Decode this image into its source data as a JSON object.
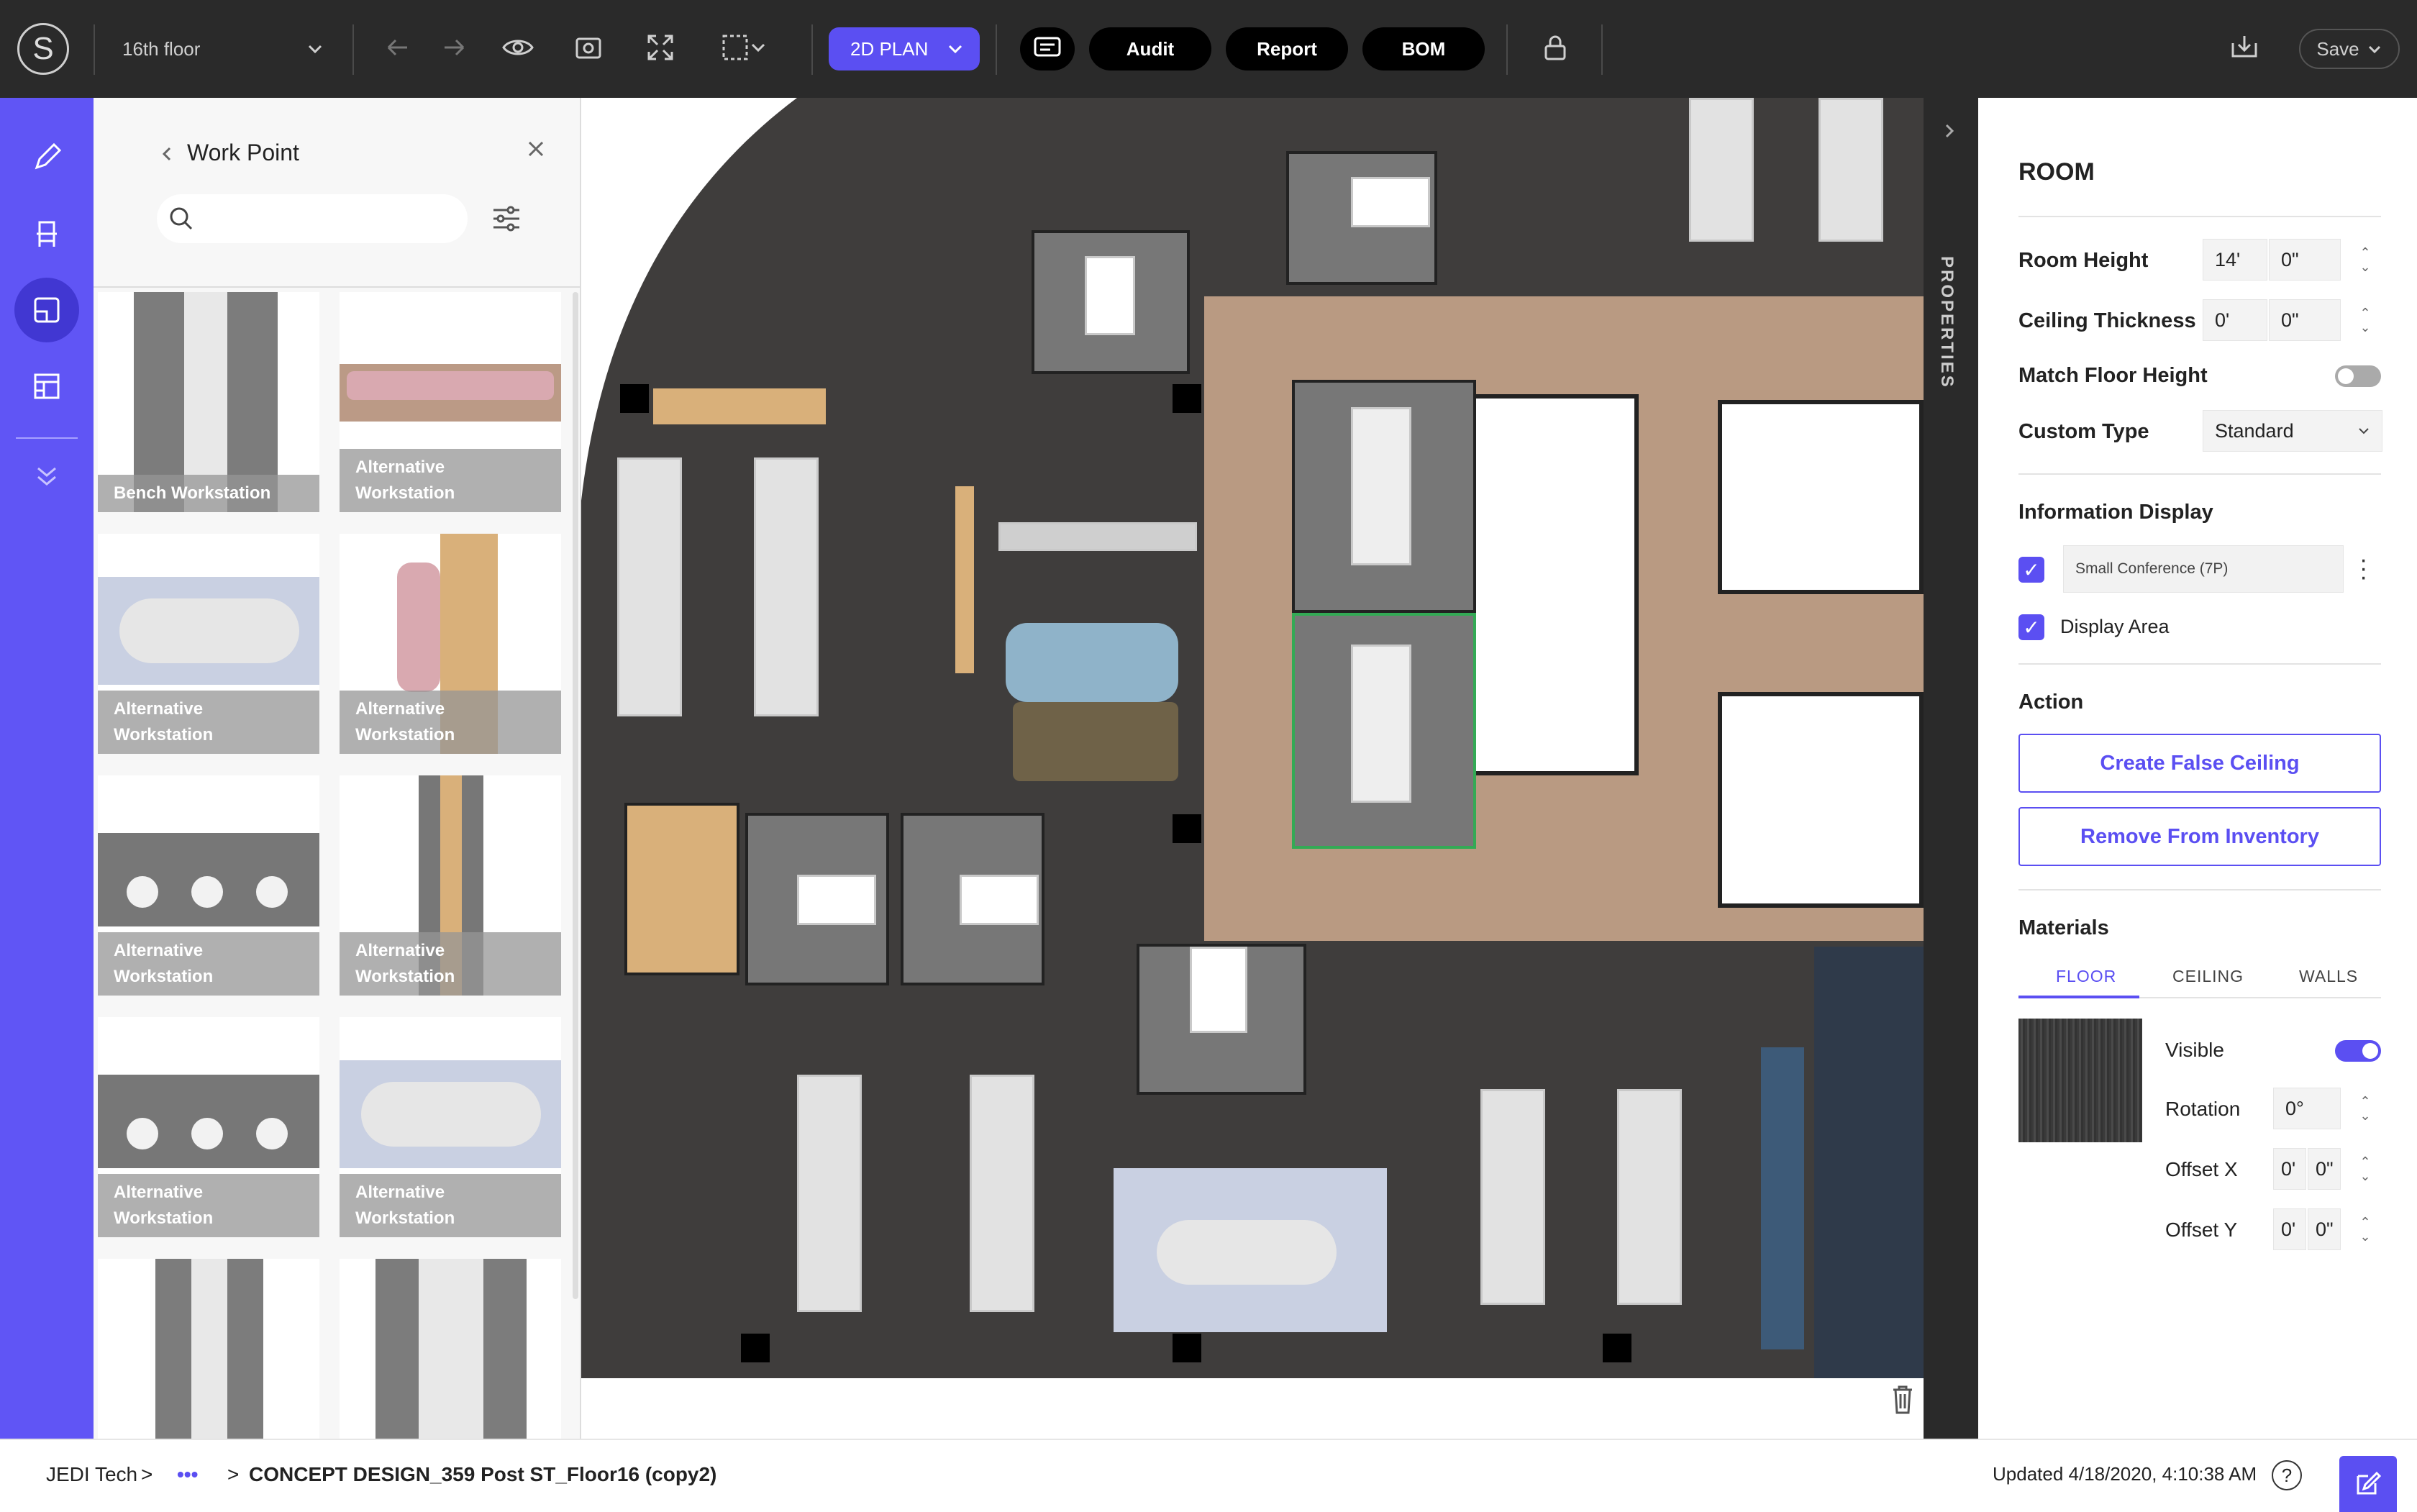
{
  "topbar": {
    "logo_letter": "S",
    "floor_select": "16th floor",
    "plan_mode": "2D PLAN",
    "pills": [
      "Audit",
      "Report",
      "BOM"
    ],
    "save_label": "Save"
  },
  "left_panel": {
    "title": "Work Point",
    "search_placeholder": "",
    "cards": [
      {
        "label": "Bench Workstation"
      },
      {
        "label": "Alternative Workstation"
      },
      {
        "label": "Alternative Workstation"
      },
      {
        "label": "Alternative Workstation"
      },
      {
        "label": "Alternative Workstation"
      },
      {
        "label": "Alternative Workstation"
      },
      {
        "label": "Alternative Workstation"
      },
      {
        "label": "Alternative Workstation"
      }
    ]
  },
  "properties_tab": "PROPERTIES",
  "room_panel": {
    "title": "ROOM",
    "room_height_label": "Room Height",
    "room_height_ft": "14'",
    "room_height_in": "0\"",
    "ceiling_thickness_label": "Ceiling Thickness",
    "ceiling_thickness_ft": "0'",
    "ceiling_thickness_in": "0\"",
    "match_floor_height_label": "Match Floor Height",
    "match_floor_height_on": false,
    "custom_type_label": "Custom Type",
    "custom_type_value": "Standard",
    "information_display_label": "Information Display",
    "info_display_value": "Small Conference (7P)",
    "display_area_label": "Display Area",
    "action_label": "Action",
    "create_false_ceiling": "Create False Ceiling",
    "remove_from_inventory": "Remove From Inventory",
    "materials_label": "Materials",
    "material_tabs": [
      "FLOOR",
      "CEILING",
      "WALLS"
    ],
    "active_tab": "FLOOR",
    "visible_label": "Visible",
    "visible_on": true,
    "rotation_label": "Rotation",
    "rotation_value": "0°",
    "offset_x_label": "Offset X",
    "offset_x_ft": "0'",
    "offset_x_in": "0\"",
    "offset_y_label": "Offset Y",
    "offset_y_ft": "0'",
    "offset_y_in": "0\""
  },
  "bottombar": {
    "org": "JEDI Tech",
    "sep1": ">",
    "more": "•••",
    "sep2": ">",
    "project": "CONCEPT DESIGN_359 Post ST_Floor16 (copy2)",
    "updated": "Updated 4/18/2020, 4:10:38 AM",
    "help": "?"
  },
  "colors": {
    "accent": "#5b4ff2",
    "topbar": "#2a2a2a",
    "rail": "#6055f5"
  }
}
